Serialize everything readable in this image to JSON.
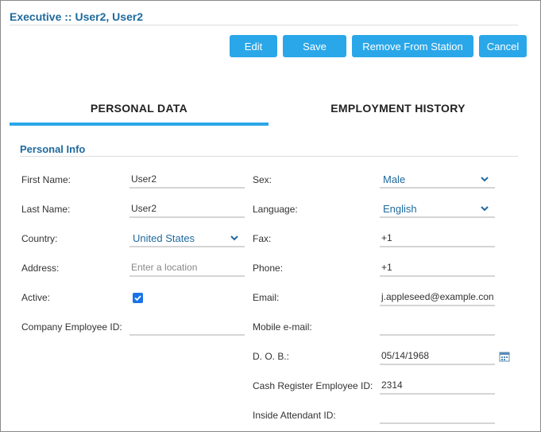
{
  "header": {
    "title": "Executive :: User2, User2"
  },
  "toolbar": {
    "edit_label": "Edit",
    "save_label": "Save",
    "remove_label": "Remove From Station",
    "cancel_label": "Cancel"
  },
  "tabs": {
    "personal": "PERSONAL DATA",
    "employment": "EMPLOYMENT HISTORY",
    "active": "personal"
  },
  "section": {
    "title": "Personal Info"
  },
  "left": {
    "first_name_label": "First Name:",
    "first_name_value": "User2",
    "last_name_label": "Last Name:",
    "last_name_value": "User2",
    "country_label": "Country:",
    "country_value": "United States",
    "address_label": "Address:",
    "address_placeholder": "Enter a location",
    "active_label": "Active:",
    "active_checked": true,
    "company_id_label": "Company Employee ID:",
    "company_id_value": ""
  },
  "right": {
    "sex_label": "Sex:",
    "sex_value": "Male",
    "language_label": "Language:",
    "language_value": "English",
    "fax_label": "Fax:",
    "fax_value": "+1",
    "phone_label": "Phone:",
    "phone_value": "+1",
    "email_label": "Email:",
    "email_value": "j.appleseed@example.con",
    "mobile_email_label": "Mobile e-mail:",
    "mobile_email_value": "",
    "dob_label": "D. O. B.:",
    "dob_value": "05/14/1968",
    "cash_register_label": "Cash Register Employee ID:",
    "cash_register_value": "2314",
    "inside_attendant_label": "Inside Attendant ID:",
    "inside_attendant_value": ""
  },
  "colors": {
    "accent": "#2aa7e8",
    "title": "#1f6a9e",
    "checkbox": "#1a73e8"
  }
}
